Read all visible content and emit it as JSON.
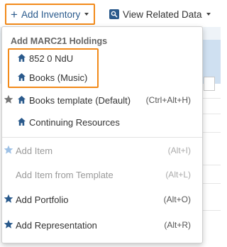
{
  "colors": {
    "accent": "#2a5a8c",
    "highlight": "#f28a1a",
    "disabled": "#9a9a9a",
    "star_default": "#777777",
    "star_light": "#9ec1e6"
  },
  "toolbar": {
    "add_inventory_label": "Add Inventory",
    "view_related_label": "View Related Data"
  },
  "menu": {
    "section_header": "Add MARC21 Holdings",
    "holdings": [
      {
        "label": "852 0 NdU",
        "icon": "house-icon"
      },
      {
        "label": "Books (Music)",
        "icon": "house-icon"
      },
      {
        "label": "Books template (Default)",
        "icon": "house-icon",
        "shortcut": "(Ctrl+Alt+H)",
        "star": "star-gray-icon"
      },
      {
        "label": "Continuing Resources",
        "icon": "house-icon"
      }
    ],
    "actions": [
      {
        "label": "Add Item",
        "shortcut": "(Alt+I)",
        "disabled": true,
        "star": "star-light-icon"
      },
      {
        "label": "Add Item from Template",
        "shortcut": "(Alt+L)",
        "disabled": true
      },
      {
        "label": "Add Portfolio",
        "shortcut": "(Alt+O)",
        "disabled": false,
        "star": "star-blue-icon"
      },
      {
        "label": "Add Representation",
        "shortcut": "(Alt+R)",
        "disabled": false,
        "star": "star-blue-icon"
      }
    ]
  }
}
